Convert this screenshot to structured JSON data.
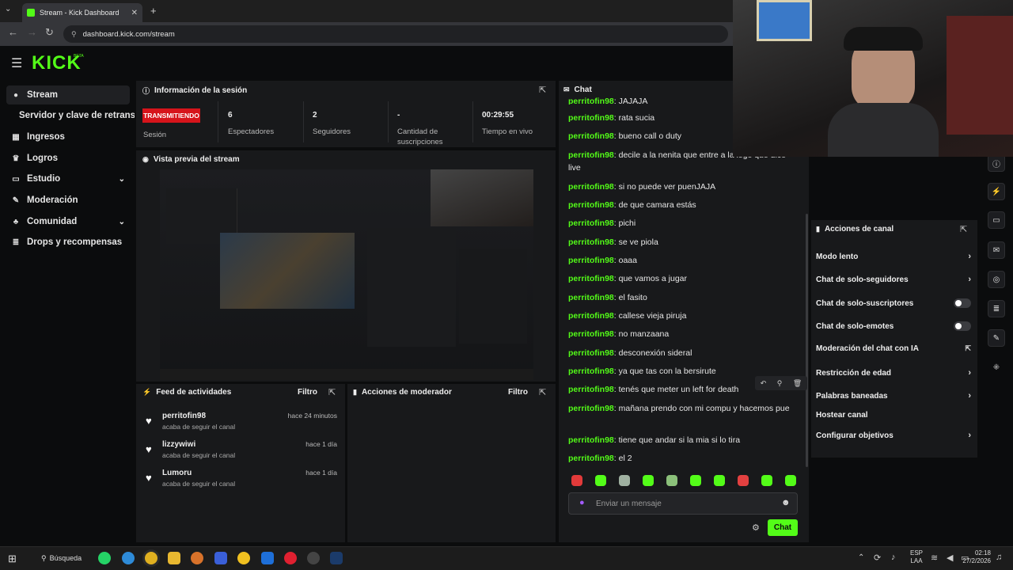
{
  "browser": {
    "tab_title": "Stream - Kick Dashboard",
    "url": "dashboard.kick.com/stream"
  },
  "brand": {
    "logo": "KICK",
    "badge": "BETA",
    "accent": "#53fc18"
  },
  "sidebar": {
    "items": [
      {
        "label": "Stream",
        "icon": "dot-icon"
      },
      {
        "label": "Servidor y clave de retransm",
        "icon": ""
      },
      {
        "label": "Ingresos",
        "icon": "bars-icon"
      },
      {
        "label": "Logros",
        "icon": "trophy-icon"
      },
      {
        "label": "Estudio",
        "icon": "monitor-icon"
      },
      {
        "label": "Moderación",
        "icon": "wrench-icon"
      },
      {
        "label": "Comunidad",
        "icon": "community-icon"
      },
      {
        "label": "Drops y recompensas",
        "icon": "list-icon"
      }
    ]
  },
  "session": {
    "title": "Información de la sesión",
    "live_badge": "TRANSMITIENDO",
    "session_label": "Sesión",
    "stats": [
      {
        "value": "6",
        "label": "Espectadores"
      },
      {
        "value": "2",
        "label": "Seguidores"
      },
      {
        "value": "-",
        "label": "Cantidad de suscripciones"
      },
      {
        "value": "00:29:55",
        "label": "Tiempo en vivo"
      }
    ]
  },
  "preview": {
    "title": "Vista previa del stream"
  },
  "activity": {
    "title": "Feed de actividades",
    "filter": "Filtro",
    "items": [
      {
        "user": "perritofin98",
        "action": "acaba de seguir el canal",
        "time": "hace 24 minutos"
      },
      {
        "user": "lizzywiwi",
        "action": "acaba de seguir el canal",
        "time": "hace 1 día"
      },
      {
        "user": "Lumoru",
        "action": "acaba de seguir el canal",
        "time": "hace 1 día"
      }
    ]
  },
  "mod_actions": {
    "title": "Acciones de moderador",
    "filter": "Filtro"
  },
  "chat": {
    "title": "Chat",
    "messages": [
      {
        "user": "perritofin98",
        "text": "JAJAJA"
      },
      {
        "user": "perritofin98",
        "text": "rata sucia"
      },
      {
        "user": "perritofin98",
        "text": "bueno call o duty"
      },
      {
        "user": "perritofin98",
        "text": "decile a la nenita que entre a la lege que dice live"
      },
      {
        "user": "perritofin98",
        "text": "si no puede ver puenJAJA"
      },
      {
        "user": "perritofin98",
        "text": "de que camara estás"
      },
      {
        "user": "perritofin98",
        "text": "pichi"
      },
      {
        "user": "perritofin98",
        "text": "se ve piola"
      },
      {
        "user": "perritofin98",
        "text": "oaaa"
      },
      {
        "user": "perritofin98",
        "text": "que vamos a jugar"
      },
      {
        "user": "perritofin98",
        "text": "el fasito"
      },
      {
        "user": "perritofin98",
        "text": "callese vieja piruja"
      },
      {
        "user": "perritofin98",
        "text": "no manzaana"
      },
      {
        "user": "perritofin98",
        "text": "desconexión sideral"
      },
      {
        "user": "perritofin98",
        "text": "ya que tas con la bersirute"
      },
      {
        "user": "perritofin98",
        "text": "tenés que meter un left for death"
      },
      {
        "user": "perritofin98",
        "text": "mañana prendo con mi compu y hacemos pue"
      },
      {
        "user": "perritofin98",
        "text": "tiene que andar si la mia si lo tira"
      },
      {
        "user": "perritofin98",
        "text": "el 2"
      }
    ],
    "input_placeholder": "Enviar un mensaje",
    "send_label": "Chat"
  },
  "channel_actions": {
    "title": "Acciones de canal",
    "items": [
      {
        "label": "Modo lento",
        "control": "chevron"
      },
      {
        "label": "Chat de solo-seguidores",
        "control": "chevron"
      },
      {
        "label": "Chat de solo-suscriptores",
        "control": "toggle"
      },
      {
        "label": "Chat de solo-emotes",
        "control": "toggle"
      },
      {
        "label": "Moderación del chat con IA",
        "control": "external"
      },
      {
        "label": "Restricción de edad",
        "control": "chevron"
      },
      {
        "label": "Palabras baneadas",
        "control": "chevron"
      },
      {
        "label": "Hostear canal",
        "control": "none"
      },
      {
        "label": "Configurar objetivos",
        "control": "chevron"
      }
    ]
  },
  "taskbar": {
    "search": "Búsqueda",
    "lang": "ESP",
    "lang2": "LAA",
    "time": "02:18",
    "date": "27/2/2026"
  }
}
